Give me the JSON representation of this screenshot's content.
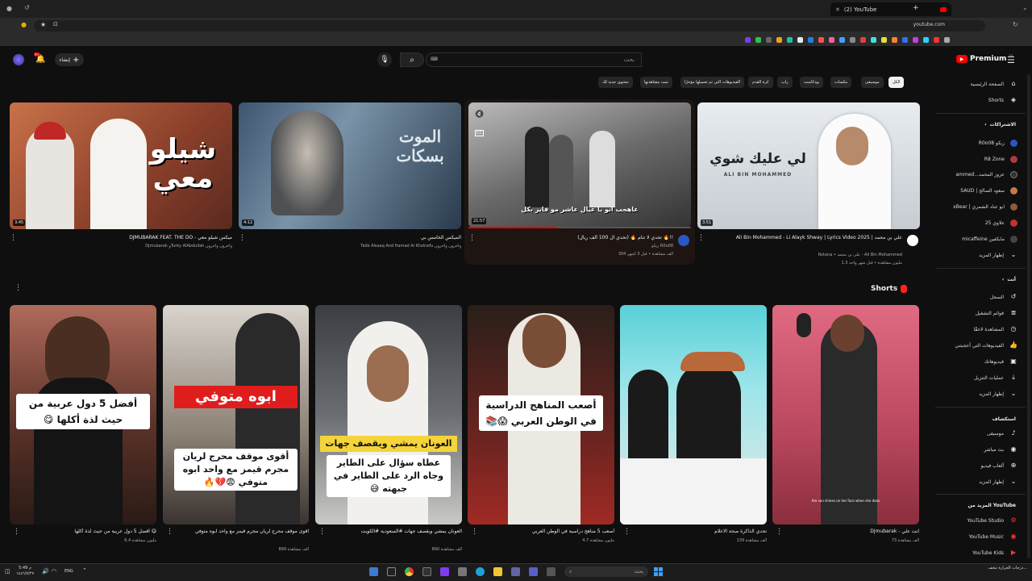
{
  "browser": {
    "tab_title": "(2) YouTube",
    "url": "youtube.com"
  },
  "header": {
    "logo_text": "Premium",
    "logo_badge": "SA",
    "search_placeholder": "بحث",
    "create_label": "إنشاء",
    "notification_count": "9+"
  },
  "chips": [
    "الكل",
    "موسيقى",
    "مكسات",
    "بودكاست",
    "راب",
    "كرة القدم",
    "الفيديوهات التي تم تحميلها مؤخرًا",
    "تمت مشاهدتها",
    "محتوى جديد لك"
  ],
  "sidebar": {
    "home": "الصفحة الرئيسية",
    "shorts": "Shorts",
    "subscriptions_header": "الاشتراكات",
    "subscriptions": [
      {
        "name": "زيكو R0o08",
        "color": "#2a57c4"
      },
      {
        "name": "R8 Zone",
        "color": "#b23a3a"
      },
      {
        "name": "عزوز المحمد...ammed",
        "color": "#333"
      },
      {
        "name": "سعود الصالح | SAUD",
        "color": "#c47a4a"
      },
      {
        "name": "ابو عناد الشمري | xBear",
        "color": "#8e5a3a"
      },
      {
        "name": "علاوي 25",
        "color": "#c23232"
      },
      {
        "name": "مايكفين micaffeine",
        "color": "#444"
      }
    ],
    "show_more": "إظهار المزيد",
    "you_header": "أنت",
    "you_items": [
      "السجل",
      "قوائم التشغيل",
      "المشاهدة لاحقًا",
      "الفيديوهات التي أعجبتني",
      "فيديوهاتك",
      "عمليات التنزيل",
      "إظهار المزيد"
    ],
    "explore_header": "استكشاف",
    "explore_items": [
      "موسيقى",
      "بث مباشر",
      "ألعاب فيديو",
      "إظهار المزيد"
    ],
    "more_header": "المزيد من YouTube",
    "more_items": [
      "YouTube Studio",
      "YouTube Music",
      "YouTube Kids"
    ]
  },
  "videos": [
    {
      "overlay": "شيلو معي",
      "duration": "3:45",
      "title": "DJMUBARAK FEAT. THE DO - ميكس شيلو معي",
      "meta": "Djmubarak وTurky AlAbdullah وآخرون وآخرون"
    },
    {
      "overlay": "الموت بسكات",
      "duration": "4:12",
      "title": "الميكس الخامس بي",
      "meta": "Talib Alsaaq And Hamad Al Khzinefu وآخرون وآخرون"
    },
    {
      "overlay": "عاهجب انو يا عيال عاشر مو فايز بكل",
      "duration": "21:57",
      "title": "تحدي لا تنام 🔥 (تحدي آل 100 ألف ريال) 🔥!!",
      "channel": "زيكو R0o08",
      "meta": "304 ألف مشاهدة • قبل 3 أشهر"
    },
    {
      "overlay": "لي عليك شوي",
      "overlay_latin": "ALI BIN MOHAMMED",
      "duration": "3:51",
      "title": "Ali Bin Mohammed - Li Alayk Shway | Lyrics Video 2025 | علي بن محمد",
      "meta": "Rotana • علي بن محمد - Ali Bin Mohammed",
      "meta2": "1.3 مليون مشاهدة • قبل شهر واحد"
    }
  ],
  "shorts_header": "Shorts",
  "shorts": [
    {
      "overlay": "أفضل 5 دول عربية من حيث لذة أكلها 😋",
      "title": "أفضل 5 دول عربية من حيث لذة أكلها 😋",
      "views": "6.4 مليون مشاهدة"
    },
    {
      "overlay_top": "ابوه متوفي",
      "overlay": "أقوى موقف محرج لريان مجرم قيمز مع واحد ابوه متوفي 😨💔🔥",
      "title": "اقوى موقف محرج لريان مجرم قيمز مع واحد ابوه متوفي",
      "views": "899 ألف مشاهدة"
    },
    {
      "overlay_top": "العونان يمشي ويقصف جهات",
      "overlay": "عطاه سؤال على الطاير وجاه الرد على الطاير في جبهته 😅",
      "title": "العونان يمشي ويقصف جهات #السعودية #الكويت",
      "views": "890 ألف مشاهدة"
    },
    {
      "overlay": "أصعب المناهج الدراسية في الوطن العربي 😱📚",
      "title": "أصعب 5 مناهج دراسية في الوطن العربي",
      "views": "4.7 مليون مشاهدة"
    },
    {
      "overlay": "",
      "title": "تحدي الذاكرة صحة الاعلام",
      "views": "139 ألف مشاهدة"
    },
    {
      "overlay": "the sun shines on her face when she does",
      "title": "Djmubarak - انت علي",
      "views": "73 ألف مشاهدة"
    }
  ],
  "taskbar": {
    "search": "بحث",
    "lang": "ENG",
    "time": "5:49 م",
    "date": "١٤٤٦/٧/٢٧",
    "weather": "درجات الحرارة تنخف..."
  }
}
